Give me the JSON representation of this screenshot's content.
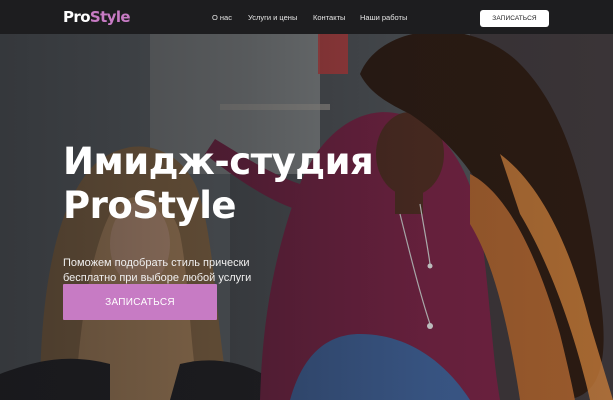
{
  "header": {
    "logo": {
      "part1": "Pro",
      "part2": "Style"
    },
    "nav": [
      "О нас",
      "Услуги и цены",
      "Контакты",
      "Наши работы"
    ],
    "cta_label": "ЗАПИСАТЬСЯ"
  },
  "hero": {
    "title_line1": "Имидж-студия",
    "title_line2": "ProStyle",
    "subtitle_line1": "Поможем  подобрать стиль прически",
    "subtitle_line2": "бесплатно при выборе любой услуги",
    "cta_label": "ЗАПИСАТЬСЯ"
  },
  "colors": {
    "header_bg": "#1d1d1f",
    "accent": "#c77bc4",
    "text_light": "#ffffff"
  }
}
